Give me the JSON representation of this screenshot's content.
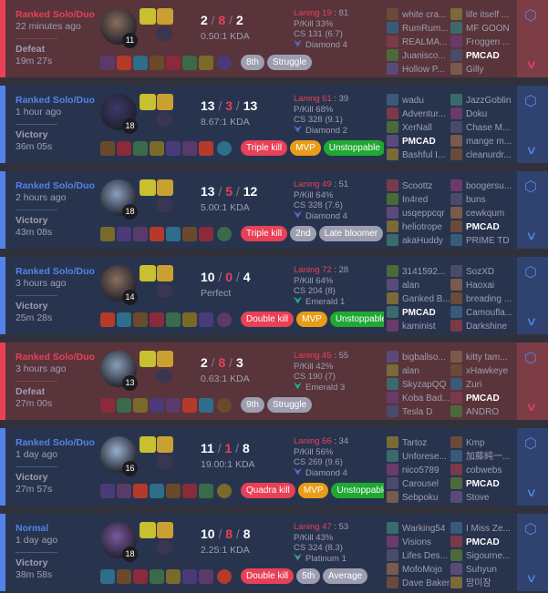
{
  "rows": [
    {
      "queue": "Ranked Solo/Duo",
      "time_ago": "22 minutes ago",
      "result": "Defeat",
      "duration": "19m 27s",
      "outcome": "loss",
      "level": "11",
      "kills": "2",
      "deaths": "8",
      "assists": "2",
      "kda_ratio": "0.50:1 KDA",
      "laning_label": "Laning 19",
      "laning_rest": " : 81",
      "pkill": "P/Kill 33%",
      "cs": "CS 131 (6.7)",
      "rank": "Diamond 4",
      "rank_color": "#576bce",
      "tags": [
        {
          "text": "8th",
          "style": "gray"
        },
        {
          "text": "Struggle",
          "style": "gray"
        }
      ],
      "team1": [
        "white cra...",
        "RumRum...",
        "REALMA...",
        "Juanisco...",
        "Hollow P..."
      ],
      "team2": [
        "life itself ...",
        "MF GOON",
        "Froggen ...",
        "PMCAD",
        "Gilly"
      ],
      "me": "PMCAD"
    },
    {
      "queue": "Ranked Solo/Duo",
      "time_ago": "1 hour ago",
      "result": "Victory",
      "duration": "36m 05s",
      "outcome": "win",
      "level": "18",
      "kills": "13",
      "deaths": "3",
      "assists": "13",
      "kda_ratio": "8.67:1 KDA",
      "laning_label": "Laning 61",
      "laning_rest": " : 39",
      "pkill": "P/Kill 68%",
      "cs": "CS 328 (9.1)",
      "rank": "Diamond 2",
      "rank_color": "#576bce",
      "tags": [
        {
          "text": "Triple kill",
          "style": "red"
        },
        {
          "text": "MVP",
          "style": "mvp"
        },
        {
          "text": "Unstoppable",
          "style": "green"
        }
      ],
      "team1": [
        "wadu",
        "Adventur...",
        "XerNall",
        "PMCAD",
        "Bashful I..."
      ],
      "team2": [
        "JazzGoblin",
        "Doku",
        "Chase M...",
        "mange m...",
        "cleanurdr..."
      ],
      "me": "PMCAD"
    },
    {
      "queue": "Ranked Solo/Duo",
      "time_ago": "2 hours ago",
      "result": "Victory",
      "duration": "43m 08s",
      "outcome": "win",
      "level": "18",
      "kills": "13",
      "deaths": "5",
      "assists": "12",
      "kda_ratio": "5.00:1 KDA",
      "laning_label": "Laning 49",
      "laning_rest": " : 51",
      "pkill": "P/Kill 64%",
      "cs": "CS 328 (7.6)",
      "rank": "Diamond 4",
      "rank_color": "#576bce",
      "tags": [
        {
          "text": "Triple kill",
          "style": "red"
        },
        {
          "text": "2nd",
          "style": "gray"
        },
        {
          "text": "Late bloomer",
          "style": "gray"
        }
      ],
      "team1": [
        "Scoottz",
        "In4red",
        "usqeppcqr",
        "heliotrope",
        "akaHuddy"
      ],
      "team2": [
        "boogersu...",
        "buns",
        "cewkqum",
        "PMCAD",
        "PRIME TD"
      ],
      "me": "PMCAD"
    },
    {
      "queue": "Ranked Solo/Duo",
      "time_ago": "3 hours ago",
      "result": "Victory",
      "duration": "25m 28s",
      "outcome": "win",
      "level": "14",
      "kills": "10",
      "deaths": "0",
      "assists": "4",
      "kda_ratio": "Perfect",
      "laning_label": "Laning 72",
      "laning_rest": " : 28",
      "pkill": "P/Kill 64%",
      "cs": "CS 204 (8)",
      "rank": "Emerald 1",
      "rank_color": "#20b07a",
      "tags": [
        {
          "text": "Double kill",
          "style": "red"
        },
        {
          "text": "MVP",
          "style": "mvp"
        },
        {
          "text": "Unstoppable",
          "style": "green"
        }
      ],
      "team1": [
        "3141592...",
        "alan",
        "Ganked B...",
        "PMCAD",
        "kaminist"
      ],
      "team2": [
        "SozXD",
        "Haoxai",
        "breading ...",
        "Camoufla...",
        "Darkshine"
      ],
      "me": "PMCAD"
    },
    {
      "queue": "Ranked Solo/Duo",
      "time_ago": "3 hours ago",
      "result": "Defeat",
      "duration": "27m 00s",
      "outcome": "loss",
      "level": "13",
      "kills": "2",
      "deaths": "8",
      "assists": "3",
      "kda_ratio": "0.63:1 KDA",
      "laning_label": "Laning 45",
      "laning_rest": " : 55",
      "pkill": "P/Kill 42%",
      "cs": "CS 190 (7)",
      "rank": "Emerald 3",
      "rank_color": "#20b07a",
      "tags": [
        {
          "text": "9th",
          "style": "gray"
        },
        {
          "text": "Struggle",
          "style": "gray"
        }
      ],
      "team1": [
        "bigballso...",
        "alan",
        "SkyzapQQ",
        "Koba Bad...",
        "Tesla D"
      ],
      "team2": [
        "kitty tam...",
        "xHawkeye",
        "Zuri",
        "PMCAD",
        "ANDRO"
      ],
      "me": "PMCAD"
    },
    {
      "queue": "Ranked Solo/Duo",
      "time_ago": "1 day ago",
      "result": "Victory",
      "duration": "27m 57s",
      "outcome": "win",
      "level": "16",
      "kills": "11",
      "deaths": "1",
      "assists": "8",
      "kda_ratio": "19.00:1 KDA",
      "laning_label": "Laning 66",
      "laning_rest": " : 34",
      "pkill": "P/Kill 56%",
      "cs": "CS 269 (9.6)",
      "rank": "Diamond 4",
      "rank_color": "#576bce",
      "tags": [
        {
          "text": "Quadra kill",
          "style": "red"
        },
        {
          "text": "MVP",
          "style": "mvp"
        },
        {
          "text": "Unstoppable",
          "style": "green"
        }
      ],
      "team1": [
        "Tartoz",
        "Unforese...",
        "nico5789",
        "Carousel",
        "Sebpoku"
      ],
      "team2": [
        "Kmp",
        "加藤純一...",
        "cobwebs",
        "PMCAD",
        "Stove"
      ],
      "me": "PMCAD"
    },
    {
      "queue": "Normal",
      "time_ago": "1 day ago",
      "result": "Victory",
      "duration": "38m 58s",
      "outcome": "win",
      "level": "18",
      "kills": "10",
      "deaths": "8",
      "assists": "8",
      "kda_ratio": "2.25:1 KDA",
      "laning_label": "Laning 47",
      "laning_rest": " : 53",
      "pkill": "P/Kill 43%",
      "cs": "CS 324 (8.3)",
      "rank": "Platinum 1",
      "rank_color": "#4e9996",
      "tags": [
        {
          "text": "Double kill",
          "style": "red"
        },
        {
          "text": "5th",
          "style": "gray"
        },
        {
          "text": "Average",
          "style": "gray"
        }
      ],
      "team1": [
        "Warking54",
        "Visions",
        "Lifes Des...",
        "MofoMojo",
        "Dave Baker"
      ],
      "team2": [
        "I Miss Ze...",
        "PMCAD",
        "Sigourne...",
        "Suhyun",
        "맘미잠"
      ],
      "me": "PMCAD"
    }
  ]
}
